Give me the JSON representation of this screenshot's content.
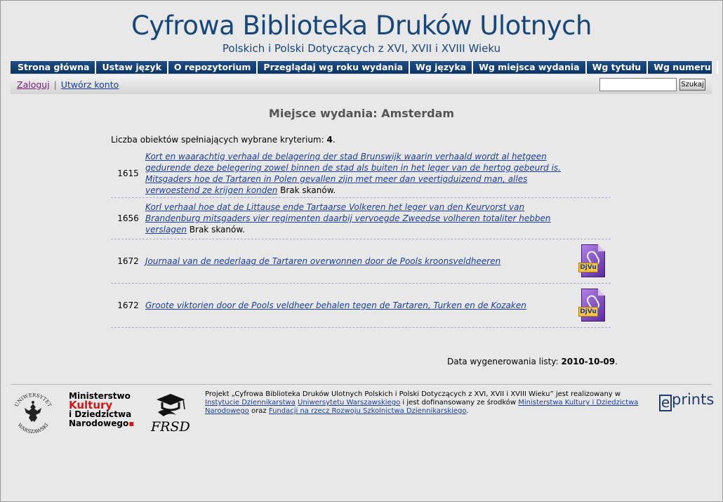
{
  "header": {
    "title": "Cyfrowa Biblioteka Druków Ulotnych",
    "subtitle": "Polskich i Polski Dotyczących z XVI, XVII i XVIII Wieku"
  },
  "menu": {
    "items": [
      {
        "label": "Strona główna"
      },
      {
        "label": "Ustaw język"
      },
      {
        "label": "O repozytorium"
      },
      {
        "label": "Przeglądaj wg roku wydania"
      },
      {
        "label": "Wg języka"
      },
      {
        "label": "Wg miejsca wydania"
      },
      {
        "label": "Wg tytułu"
      },
      {
        "label": "Wg numeru"
      }
    ]
  },
  "toolbar": {
    "login_label": "Zaloguj",
    "separator": "|",
    "register_label": "Utwórz konto",
    "search_value": "",
    "search_button_label": "Szukaj"
  },
  "main": {
    "page_title": "Miejsce wydania: Amsterdam",
    "count_prefix": "Liczba obiektów spełniających wybrane kryterium: ",
    "count_value": "4",
    "count_suffix": ".",
    "results": [
      {
        "year": "1615",
        "title": "Kort en waarachtig verhaal de belagering der stad Brunswijk waarin verhaald wordt al hetgeen gedurende deze belegering zowel binnen de stad als buiten in het leger van de hertog gebeurd is. Mitsgaders hoe de Tartaren in Polen gevallen zijn met meer dan veertigduizend man, alles verwoestend ze krijgen konden",
        "note": " Brak skanów.",
        "has_djvu": false
      },
      {
        "year": "1656",
        "title": "Korl verhaal hoe dat de Littause ende Tartaarse Volkeren het leger van den Keurvorst van Brandenburg mitsgaders vier regimenten daarbij vervoegde Zweedse volheren totaliter hebben verslagen",
        "note": " Brak skanów.",
        "has_djvu": false
      },
      {
        "year": "1672",
        "title": "Journaal van de nederlaag de Tartaren overwonnen door de Pools kroonsveldheeren",
        "note": "",
        "has_djvu": true,
        "djvu_label": "DjVu",
        "djvu_icon": "djvu-file-icon"
      },
      {
        "year": "1672",
        "title": "Groote viktorien door de Pools veldheer behalen tegen de Tartaren, Turken en de Kozaken",
        "note": "",
        "has_djvu": true,
        "djvu_label": "DjVu",
        "djvu_icon": "djvu-file-icon"
      }
    ],
    "generated_prefix": "Data wygenerowania listy: ",
    "generated_date": "2010-10-09",
    "generated_suffix": "."
  },
  "footer": {
    "uw_logo": "university-of-warsaw-logo",
    "uw_logo_text_top": "UNIWERSYTET",
    "uw_logo_text_bottom": "WARSZAWSKI",
    "mk_line1": "Ministerstwo",
    "mk_line2": "Kultury",
    "mk_line3": "i Dziedzictwa",
    "mk_line4": "Narodowego",
    "frsd_label": "FRSD",
    "text_1": "Projekt „Cyfrowa Biblioteka Druków Ulotnych Polskich i Polski Dotyczących z XVI, XVII i XVIII Wieku” jest realizowany w ",
    "link_1": "Instytucie Dziennikarstwa",
    "text_2": " ",
    "link_2": "Uniwersytetu Warszawskiego",
    "text_3": " i jest dofinansowany ze środków ",
    "link_3": "Ministerstwa Kultury i Dziedzictwa Narodowego",
    "text_4": " oraz ",
    "link_4": "Fundacji na rzecz Rozwoju Szkolnictwa Dziennikarskiego",
    "text_5": ".",
    "eprints_e": "e",
    "eprints_rest": "prints"
  }
}
